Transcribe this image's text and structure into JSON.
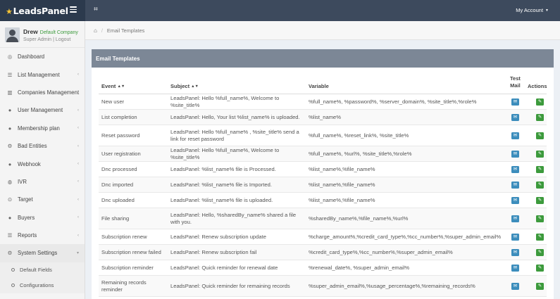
{
  "brand": {
    "name": "LeadsPanel"
  },
  "topbar": {
    "account_label": "My Account"
  },
  "user": {
    "name": "Drew",
    "company": "Default Company",
    "role": "Super Admin",
    "logout": "Logout"
  },
  "sidebar": {
    "items": [
      {
        "label": "Dashboard",
        "icon": "dashboard-icon",
        "glyph": "◎",
        "arrow": false
      },
      {
        "label": "List Management",
        "icon": "list-icon",
        "glyph": "☰",
        "arrow": true
      },
      {
        "label": "Companies Management",
        "icon": "building-icon",
        "glyph": "▥",
        "arrow": true
      },
      {
        "label": "User Management",
        "icon": "user-icon",
        "glyph": "●",
        "arrow": true
      },
      {
        "label": "Membership plan",
        "icon": "user-icon",
        "glyph": "●",
        "arrow": true
      },
      {
        "label": "Bad Entities",
        "icon": "cogs-icon",
        "glyph": "⚙",
        "arrow": true
      },
      {
        "label": "Webhook",
        "icon": "user-icon",
        "glyph": "●",
        "arrow": true
      },
      {
        "label": "IVR",
        "icon": "headset-icon",
        "glyph": "◍",
        "arrow": true
      },
      {
        "label": "Target",
        "icon": "target-icon",
        "glyph": "⊙",
        "arrow": true
      },
      {
        "label": "Buyers",
        "icon": "users-icon",
        "glyph": "●",
        "arrow": true
      },
      {
        "label": "Reports",
        "icon": "list-icon",
        "glyph": "☰",
        "arrow": true
      },
      {
        "label": "System Settings",
        "icon": "cogs-icon",
        "glyph": "⚙",
        "arrow": true,
        "expanded": true
      }
    ],
    "sub_items": [
      {
        "label": "Default Fields"
      },
      {
        "label": "Configurations"
      }
    ]
  },
  "breadcrumb": {
    "current": "Email Templates"
  },
  "panel": {
    "title": "Email Templates"
  },
  "table": {
    "headers": {
      "event": "Event",
      "subject": "Subject",
      "variable": "Variable",
      "test_mail_1": "Test",
      "test_mail_2": "Mail",
      "actions": "Actions"
    },
    "rows": [
      {
        "event": "New user",
        "subject": "LeadsPanel: Hello %full_name%, Welcome to %site_title%",
        "variable": "%full_name%, %password%, %server_domain%, %site_title%,%role%",
        "h": 22
      },
      {
        "event": "List completion",
        "subject": "LeadsPanel: Hello, Your list %list_name% is uploaded.",
        "variable": "%list_name%",
        "h": 22
      },
      {
        "event": "Reset password",
        "subject": "LeadsPanel: Hello %full_name% , %site_title% send a link for reset password",
        "variable": "%full_name%, %reset_link%, %site_title%",
        "h": 30
      },
      {
        "event": "User registration",
        "subject": "LeadsPanel: Hello %full_name%, Welcome to %site_title%",
        "variable": "%full_name%, %url%, %site_title%,%role%",
        "h": 22
      },
      {
        "event": "Dnc processed",
        "subject": "LeadsPanel: %list_name% file is Processed.",
        "variable": "%list_name%,%file_name%",
        "h": 22
      },
      {
        "event": "Dnc imported",
        "subject": "LeadsPanel: %list_name% file is Imported.",
        "variable": "%list_name%,%file_name%",
        "h": 22
      },
      {
        "event": "Dnc uploaded",
        "subject": "LeadsPanel: %list_name% file is uploaded.",
        "variable": "%list_name%,%file_name%",
        "h": 22
      },
      {
        "event": "File sharing",
        "subject": "LeadsPanel: Hello, %sharedBy_name% shared a file with you.",
        "variable": "%sharedBy_name%,%file_name%,%url%",
        "h": 30
      },
      {
        "event": "Subscription renew",
        "subject": "LeadsPanel: Renew subscription update",
        "variable": "%charge_amount%,%credit_card_type%,%cc_number%,%super_admin_email%",
        "h": 22
      },
      {
        "event": "Subscription renew failed",
        "subject": "LeadsPanel: Renew subscription fail",
        "variable": "%credit_card_type%,%cc_number%,%super_admin_email%",
        "h": 22
      },
      {
        "event": "Subscription reminder",
        "subject": "LeadsPanel: Quick reminder for renewal date",
        "variable": "%renewal_date%, %super_admin_email%",
        "h": 22
      },
      {
        "event": "Remaining records reminder",
        "subject": "LeadsPanel: Quick reminder for remaining records",
        "variable": "%super_admin_email%,%usage_percentage%,%remaining_records%",
        "h": 30
      }
    ]
  }
}
